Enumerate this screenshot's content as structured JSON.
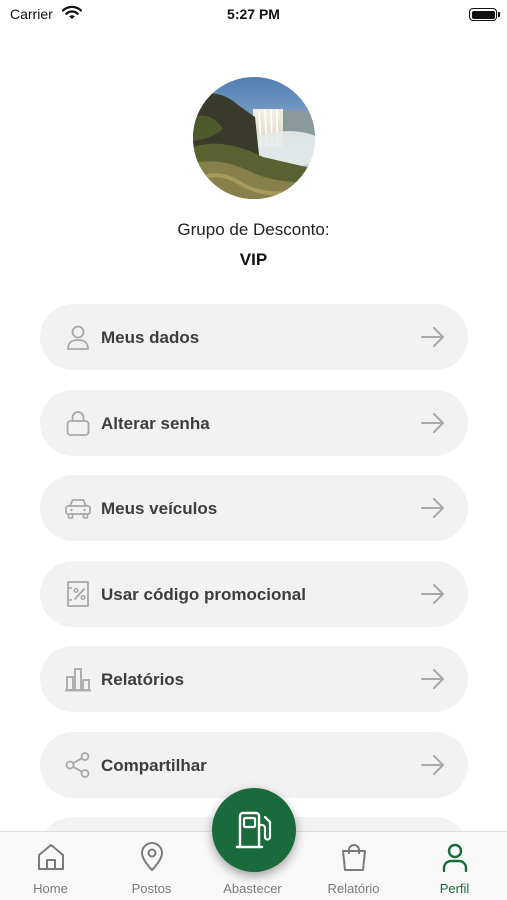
{
  "status_bar": {
    "carrier": "Carrier",
    "time": "5:27 PM"
  },
  "profile": {
    "group_label": "Grupo de Desconto:",
    "group_value": "VIP"
  },
  "menu": [
    {
      "label": "Meus dados",
      "icon": "user-icon"
    },
    {
      "label": "Alterar senha",
      "icon": "lock-icon"
    },
    {
      "label": "Meus veículos",
      "icon": "car-icon"
    },
    {
      "label": "Usar código promocional",
      "icon": "percent-ticket-icon"
    },
    {
      "label": "Relatórios",
      "icon": "bar-chart-icon"
    },
    {
      "label": "Compartilhar",
      "icon": "share-icon"
    }
  ],
  "tab_bar": {
    "tabs": [
      {
        "label": "Home",
        "icon": "home-icon"
      },
      {
        "label": "Postos",
        "icon": "map-pin-icon"
      },
      {
        "label": "Abastecer",
        "icon": "fuel-pump-icon"
      },
      {
        "label": "Relatório",
        "icon": "shopping-bag-icon"
      },
      {
        "label": "Perfil",
        "icon": "person-icon"
      }
    ],
    "active_tab": "Perfil"
  },
  "colors": {
    "accent": "#1a6b3c",
    "item_bg": "#f2f2f2",
    "icon_gray": "#a8a8a8"
  }
}
